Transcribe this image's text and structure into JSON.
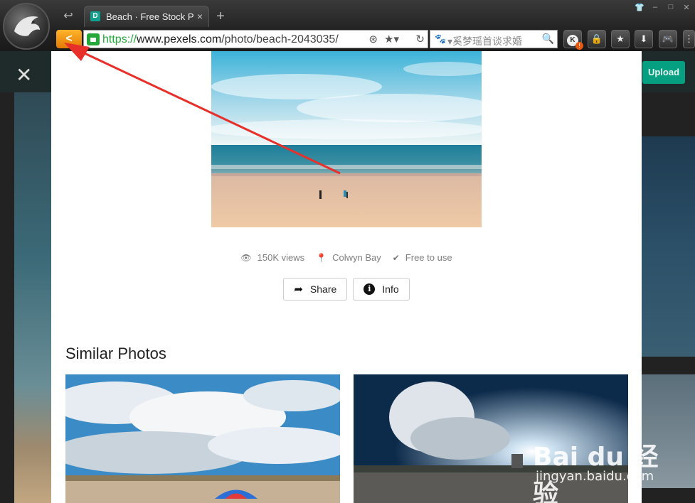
{
  "browser": {
    "tab_title": "Beach · Free Stock P",
    "tab_favicon": "D",
    "tab_close": "×",
    "new_tab": "+",
    "back_label": "<",
    "url_protocol": "https://",
    "url_host": "www.pexels.com",
    "url_path": "/photo/beach-2043035/",
    "search_placeholder": "▾奚梦瑶首谈求婚",
    "window_controls": [
      "👕",
      "–",
      "□",
      "✕"
    ],
    "toolbar_icons": [
      "k-extension-icon",
      "lock-icon",
      "star-icon",
      "download-icon",
      "gamepad-icon"
    ],
    "ext_k_letter": "K",
    "ext_alert": "!",
    "accent_back": "#f39a15",
    "secure_green": "#24a83a"
  },
  "page": {
    "close_glyph": "✕",
    "upload_label": "Upload",
    "stats": [
      {
        "icon": "eye-icon",
        "glyph": "👁",
        "text": "150K views"
      },
      {
        "icon": "location-pin-icon",
        "glyph": "📍",
        "text": "Colwyn Bay"
      },
      {
        "icon": "check-circle-icon",
        "glyph": "✔",
        "text": "Free to use"
      }
    ],
    "share_label": "Share",
    "info_label": "Info",
    "info_glyph": "i",
    "share_glyph": "➦",
    "similar_title": "Similar Photos",
    "accent_upload": "#05a081"
  },
  "watermark": {
    "brand": "Bai du 经验",
    "domain": "jingyan.baidu.com"
  },
  "annotation": {
    "color": "#e8302a",
    "points_at": "back-button"
  }
}
